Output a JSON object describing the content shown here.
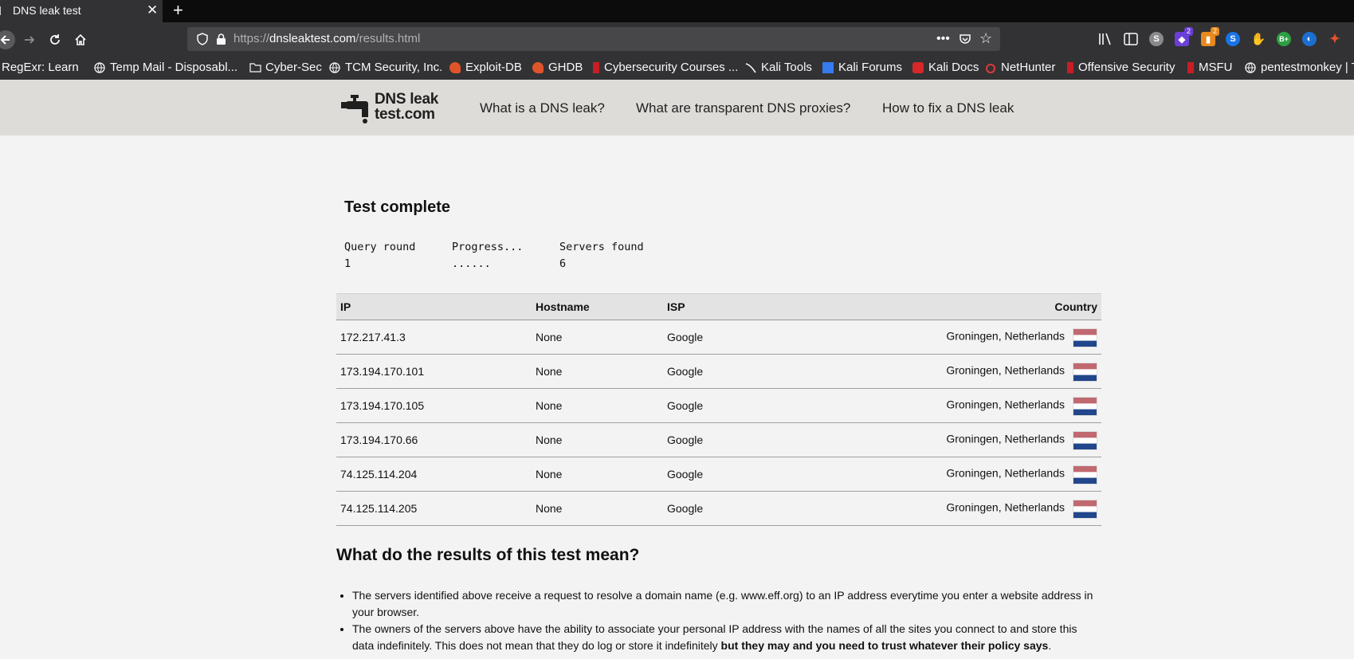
{
  "browser": {
    "tab_title": "DNS leak test",
    "url_prefix": "https://",
    "url_host": "dnsleaktest.com",
    "url_path": "/results.html",
    "ext_badge_1": "2",
    "ext_badge_2": "2",
    "bookmarks": [
      {
        "label": "RegExr: Learn",
        "icon": "regexr-icon"
      },
      {
        "label": "Temp Mail - Disposabl...",
        "icon": "globe-icon"
      },
      {
        "label": "Cyber-Sec",
        "icon": "folder-icon"
      },
      {
        "label": "TCM Security, Inc.",
        "icon": "globe-icon"
      },
      {
        "label": "Exploit-DB",
        "icon": "exploitdb-icon"
      },
      {
        "label": "GHDB",
        "icon": "exploitdb-icon"
      },
      {
        "label": "Cybersecurity Courses ...",
        "icon": "dragon-icon"
      },
      {
        "label": "Kali Tools",
        "icon": "kali-icon"
      },
      {
        "label": "Kali Forums",
        "icon": "kali-icon"
      },
      {
        "label": "Kali Docs",
        "icon": "kali-icon"
      },
      {
        "label": "NetHunter",
        "icon": "nethunter-icon"
      },
      {
        "label": "Offensive Security",
        "icon": "offsec-icon"
      },
      {
        "label": "MSFU",
        "icon": "offsec-icon"
      },
      {
        "label": "pentestmonkey | T",
        "icon": "globe-icon"
      }
    ]
  },
  "site": {
    "logo_line1": "DNS leak",
    "logo_line2": "test.com",
    "nav": [
      "What is a DNS leak?",
      "What are transparent DNS proxies?",
      "How to fix a DNS leak"
    ]
  },
  "test": {
    "heading": "Test complete",
    "query_round_label": "Query round",
    "query_round_value": "1",
    "progress_label": "Progress...",
    "progress_value": "......",
    "servers_label": "Servers found",
    "servers_value": "6"
  },
  "table": {
    "headers": [
      "IP",
      "Hostname",
      "ISP",
      "Country"
    ],
    "rows": [
      {
        "ip": "172.217.41.3",
        "hostname": "None",
        "isp": "Google",
        "country": "Groningen, Netherlands"
      },
      {
        "ip": "173.194.170.101",
        "hostname": "None",
        "isp": "Google",
        "country": "Groningen, Netherlands"
      },
      {
        "ip": "173.194.170.105",
        "hostname": "None",
        "isp": "Google",
        "country": "Groningen, Netherlands"
      },
      {
        "ip": "173.194.170.66",
        "hostname": "None",
        "isp": "Google",
        "country": "Groningen, Netherlands"
      },
      {
        "ip": "74.125.114.204",
        "hostname": "None",
        "isp": "Google",
        "country": "Groningen, Netherlands"
      },
      {
        "ip": "74.125.114.205",
        "hostname": "None",
        "isp": "Google",
        "country": "Groningen, Netherlands"
      }
    ],
    "flag_colors": [
      "#ae1c28",
      "#ffffff",
      "#21468b"
    ]
  },
  "explanation": {
    "heading": "What do the results of this test mean?",
    "item1": "The servers identified above receive a request to resolve a domain name (e.g. www.eff.org) to an IP address everytime you enter a website address in your browser.",
    "item2_plain": "The owners of the servers above have the ability to associate your personal IP address with the names of all the sites you connect to and store this data indefinitely. This does not mean that they do log or store it indefinitely ",
    "item2_bold": "but they may and you need to trust whatever their policy says",
    "item2_end": "."
  }
}
